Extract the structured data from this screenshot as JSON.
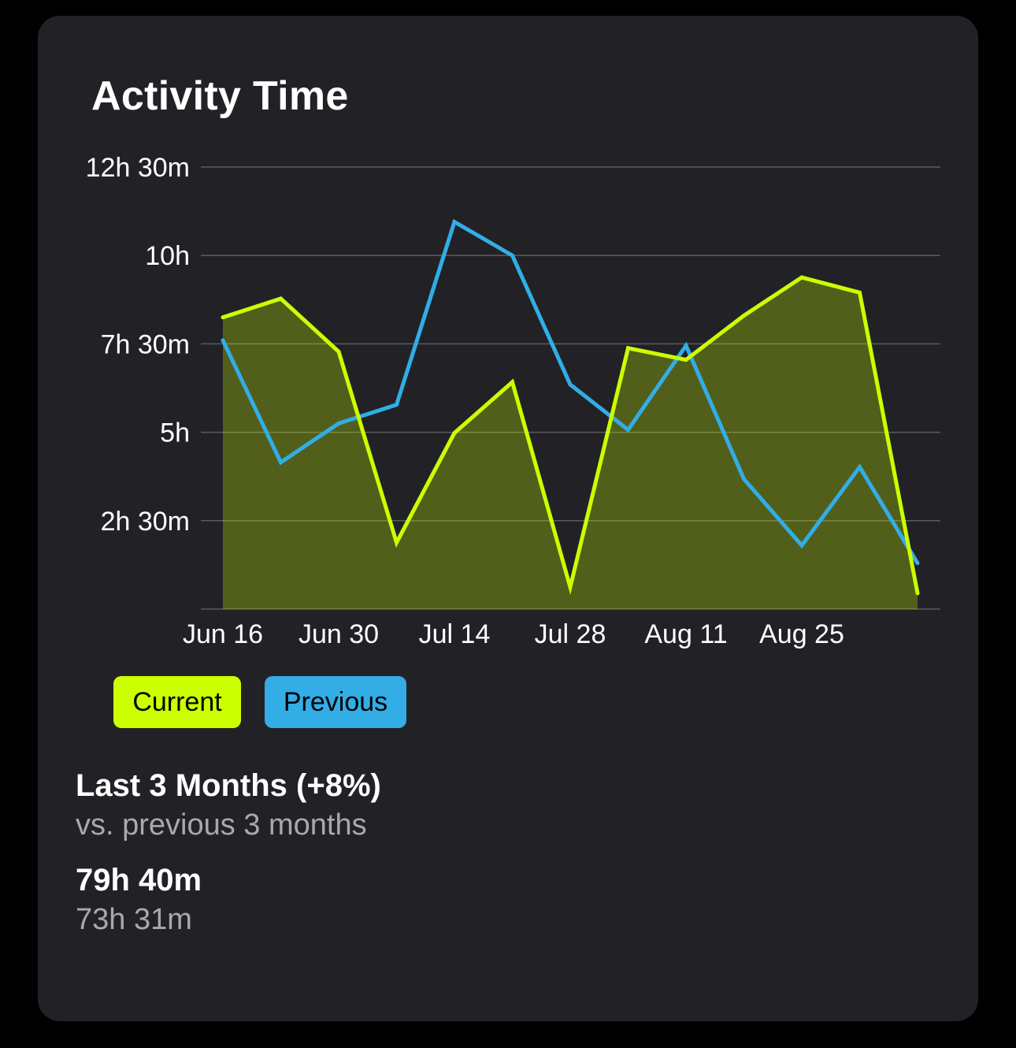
{
  "card": {
    "title": "Activity Time"
  },
  "chart_data": {
    "type": "line",
    "title": "Activity Time",
    "xlabel": "",
    "ylabel": "",
    "x_tick_labels": [
      "Jun 16",
      "Jun 30",
      "Jul 14",
      "Jul 28",
      "Aug 11",
      "Aug 25"
    ],
    "y_tick_labels": [
      "2h 30m",
      "5h",
      "7h 30m",
      "10h",
      "12h 30m"
    ],
    "y_tick_values_hours": [
      2.5,
      5,
      7.5,
      10,
      12.5
    ],
    "ylim_hours": [
      0,
      12.5
    ],
    "x_points": [
      "Jun 16",
      "Jun 23",
      "Jun 30",
      "Jul 7",
      "Jul 14",
      "Jul 21",
      "Jul 28",
      "Aug 4",
      "Aug 11",
      "Aug 18",
      "Aug 25",
      "Sep 1",
      "Sep 8"
    ],
    "series": [
      {
        "name": "Current",
        "color": "#CCFF00",
        "fill": true,
        "values_hours": [
          8.25,
          8.78,
          7.28,
          1.88,
          4.98,
          6.42,
          0.62,
          7.38,
          7.05,
          8.3,
          9.38,
          8.95,
          0.45
        ]
      },
      {
        "name": "Previous",
        "color": "#32ADE6",
        "fill": false,
        "values_hours": [
          7.6,
          4.15,
          5.25,
          5.78,
          10.95,
          10.0,
          6.35,
          5.07,
          7.45,
          3.68,
          1.8,
          4.02,
          1.3
        ]
      }
    ],
    "grid": true,
    "legend_position": "bottom-left"
  },
  "legend": {
    "current_label": "Current",
    "previous_label": "Previous",
    "current_color": "#CCFF00",
    "previous_color": "#32ADE6"
  },
  "summary": {
    "title": "Last 3 Months (+8%)",
    "subtitle": "vs. previous 3 months",
    "current_total": "79h 40m",
    "previous_total": "73h 31m"
  }
}
